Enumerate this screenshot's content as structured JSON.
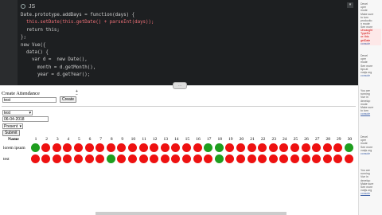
{
  "editor": {
    "tab_label": "JS",
    "code_lines": [
      "Date.prototype.addDays = function(days) {",
      "  this.setDate(this.getDate() + parseInt(days));",
      "  return this;",
      "};",
      "new Vue({",
      "  data() {",
      "    var d =  new Date(),",
      "      month = d.getMonth(),",
      "      year = d.getYear();"
    ],
    "resize_label": "···"
  },
  "form": {
    "heading": "Create Attendance",
    "name_value": "test",
    "create_label": "Create",
    "student_select": "test",
    "date_value": "06-04-2018",
    "status_select": "Present",
    "submit_label": "Submit"
  },
  "table": {
    "name_header": "Name",
    "days": [
      "1",
      "2",
      "3",
      "4",
      "5",
      "6",
      "7",
      "8",
      "9",
      "10",
      "11",
      "12",
      "13",
      "14",
      "15",
      "16",
      "17",
      "18",
      "19",
      "20",
      "21",
      "22",
      "23",
      "24",
      "25",
      "26",
      "27",
      "28",
      "29",
      "30"
    ],
    "rows": [
      {
        "name": "lorem ipsum",
        "present": [
          1,
          0,
          0,
          0,
          0,
          0,
          0,
          0,
          0,
          0,
          0,
          0,
          0,
          0,
          0,
          0,
          1,
          1,
          0,
          0,
          0,
          0,
          0,
          0,
          0,
          0,
          0,
          0,
          0,
          1
        ]
      },
      {
        "name": "test",
        "present": [
          0,
          0,
          0,
          0,
          0,
          0,
          0,
          1,
          0,
          0,
          0,
          0,
          0,
          0,
          0,
          0,
          0,
          1,
          0,
          0,
          0,
          0,
          0,
          0,
          0,
          0,
          0,
          0,
          0,
          0
        ]
      }
    ]
  },
  "console": {
    "messages": [
      {
        "lines": [
          "Devel",
          "oper",
          "mode",
          "Make sure",
          "to turn",
          "productio",
          "n mode",
          "See more",
          "tips at",
          "https://v",
          "uejs.org/"
        ],
        "error": false,
        "link": "console"
      },
      {
        "lines": [
          "Uncaught",
          "TypeErr",
          "or: this",
          "getDate"
        ],
        "error": true,
        "link": "console"
      },
      {
        "lines": [
          "Devel",
          "oper",
          "mode",
          "See more",
          "tips at",
          "vuejs.org"
        ],
        "error": false,
        "link": "console"
      },
      {
        "lines": [
          "You are",
          "running",
          "Vue in",
          "develop",
          "mode",
          "Make sure",
          "to turn"
        ],
        "error": false,
        "link": "console"
      },
      {
        "lines": [
          "Devel",
          "oper",
          "mode",
          "See more",
          "vuejs.org"
        ],
        "error": false,
        "link": "console"
      },
      {
        "lines": [
          "You are",
          "running",
          "Vue in",
          "develop",
          "Make sure",
          "See more",
          "vuejs.org"
        ],
        "error": false,
        "link": "console"
      }
    ]
  },
  "colors": {
    "present": "#1f9e1f",
    "absent": "#ee1111",
    "editor_bg": "#1d1f21"
  }
}
